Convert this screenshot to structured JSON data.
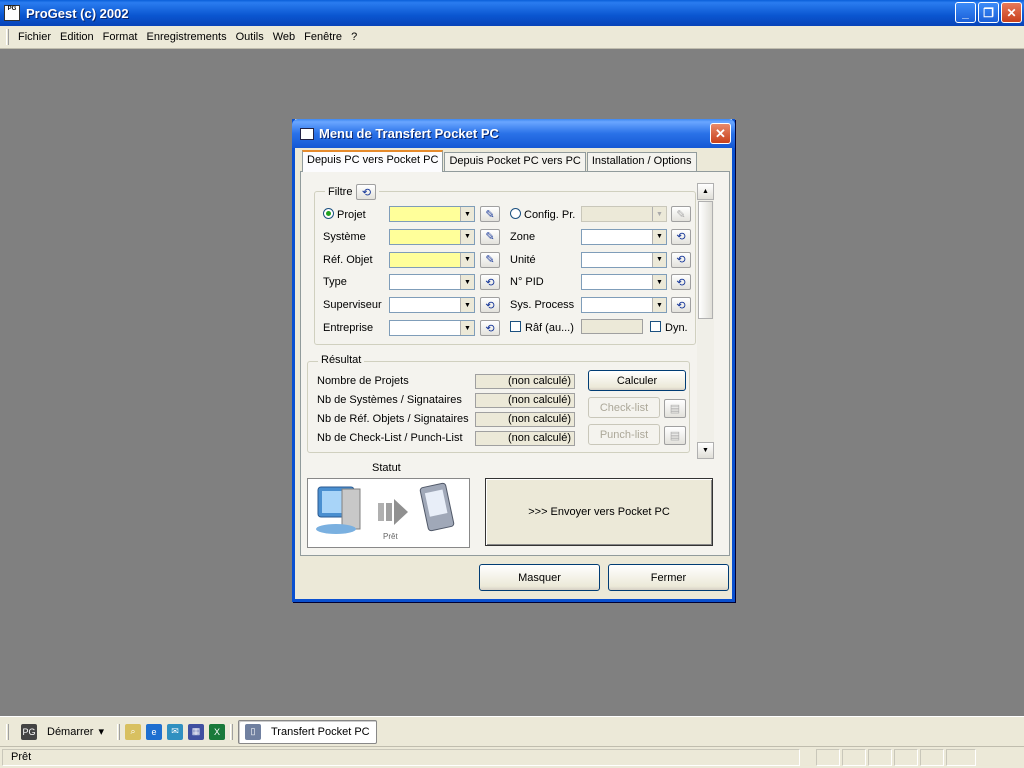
{
  "app": {
    "title": "ProGest (c) 2002",
    "icon_label": "PG"
  },
  "menubar": {
    "items": [
      "Fichier",
      "Edition",
      "Format",
      "Enregistrements",
      "Outils",
      "Web",
      "Fenêtre",
      "?"
    ]
  },
  "dialog": {
    "title": "Menu de Transfert Pocket PC",
    "tabs": [
      "Depuis PC vers Pocket PC",
      "Depuis Pocket PC vers PC",
      "Installation / Options"
    ],
    "active_tab": 0,
    "filtre": {
      "title": "Filtre",
      "left": [
        {
          "label": "Projet",
          "radio": true,
          "selected": true,
          "highlight": true,
          "button_icon": "edit-icon"
        },
        {
          "label": "Système",
          "highlight": true,
          "button_icon": "edit-icon"
        },
        {
          "label": "Réf. Objet",
          "highlight": true,
          "button_icon": "edit-icon"
        },
        {
          "label": "Type",
          "highlight": false,
          "button_icon": "undo-icon"
        },
        {
          "label": "Superviseur",
          "highlight": false,
          "button_icon": "undo-icon"
        },
        {
          "label": "Entreprise",
          "highlight": false,
          "button_icon": "undo-icon"
        }
      ],
      "right": [
        {
          "label": "Config. Pr.",
          "radio": true,
          "selected": false,
          "disabled": true,
          "button_icon": "edit-icon"
        },
        {
          "label": "Zone",
          "button_icon": "undo-icon"
        },
        {
          "label": "Unité",
          "button_icon": "undo-icon"
        },
        {
          "label": "N° PID",
          "button_icon": "undo-icon"
        },
        {
          "label": "Sys. Process",
          "button_icon": "undo-icon"
        }
      ],
      "raf_label": "Râf (au...)",
      "dyn_label": "Dyn."
    },
    "resultat": {
      "title": "Résultat",
      "rows": [
        {
          "label": "Nombre de Projets",
          "value": "(non calculé)"
        },
        {
          "label": "Nb de Systèmes / Signataires",
          "value": "(non calculé)"
        },
        {
          "label": "Nb de Réf. Objets / Signataires",
          "value": "(non calculé)"
        },
        {
          "label": "Nb de Check-List / Punch-List",
          "value": "(non calculé)"
        }
      ],
      "calculer": "Calculer",
      "checklist": "Check-list",
      "punchlist": "Punch-list"
    },
    "statut": {
      "title": "Statut",
      "state": "Prêt"
    },
    "send_button": ">>>  Envoyer vers Pocket PC",
    "masquer": "Masquer",
    "fermer": "Fermer"
  },
  "taskbar": {
    "start": "Démarrer",
    "quicklaunch": [
      "search-icon",
      "ie-icon",
      "outlook-icon",
      "calculator-icon",
      "excel-icon"
    ],
    "task": "Transfert Pocket PC"
  },
  "statusbar": {
    "text": "Prêt"
  }
}
